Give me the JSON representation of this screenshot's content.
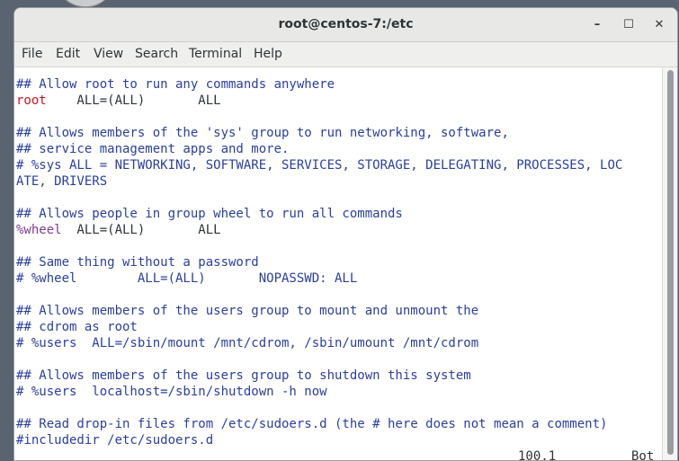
{
  "window": {
    "title": "root@centos-7:/etc",
    "minimize_glyph": "–",
    "maximize_glyph": "☐",
    "close_glyph": "✕"
  },
  "menu": [
    "File",
    "Edit",
    "View",
    "Search",
    "Terminal",
    "Help"
  ],
  "lines": [
    "## Allow root to run any commands anywhere",
    "",
    "",
    "## Allows members of the 'sys' group to run networking, software,",
    "## service management apps and more.",
    "# %sys ALL = NETWORKING, SOFTWARE, SERVICES, STORAGE, DELEGATING, PROCESSES, LOC",
    "ATE, DRIVERS",
    "",
    "## Allows people in group wheel to run all commands",
    "",
    "",
    "## Same thing without a password",
    "# %wheel        ALL=(ALL)       NOPASSWD: ALL",
    "",
    "## Allows members of the users group to mount and unmount the",
    "## cdrom as root",
    "# %users  ALL=/sbin/mount /mnt/cdrom, /sbin/umount /mnt/cdrom",
    "",
    "## Allows members of the users group to shutdown this system",
    "# %users  localhost=/sbin/shutdown -h now",
    "",
    "## Read drop-in files from /etc/sudoers.d (the # here does not mean a comment)",
    "#includedir /etc/sudoers.d"
  ],
  "root_rule": {
    "user": "root",
    "rest": "    ALL=(ALL)       ALL"
  },
  "wheel_rule": {
    "user": "%wheel",
    "rest": "  ALL=(ALL)       ALL"
  },
  "status": {
    "position": "100,1",
    "scroll": "Bot"
  },
  "colors": {
    "comment": "#2a3f9e",
    "user": "#c4161c",
    "group": "#7d3c8f",
    "text": "#2e3436"
  }
}
